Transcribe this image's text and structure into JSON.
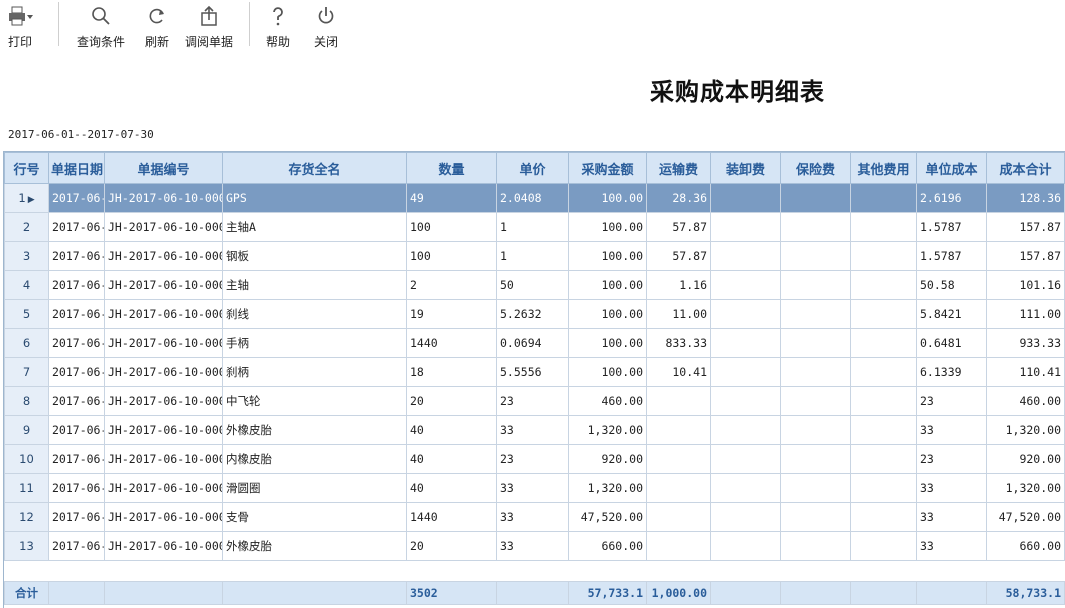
{
  "toolbar": {
    "print": "打印",
    "query": "查询条件",
    "refresh": "刷新",
    "open_doc": "调阅单据",
    "help": "帮助",
    "close": "关闭"
  },
  "report": {
    "title": "采购成本明细表",
    "date_range": "2017-06-01--2017-07-30"
  },
  "columns": [
    "行号",
    "单据日期",
    "单据编号",
    "存货全名",
    "数量",
    "单价",
    "采购金额",
    "运输费",
    "装卸费",
    "保险费",
    "其他费用",
    "单位成本",
    "成本合计"
  ],
  "rows": [
    {
      "no": "1",
      "date": "2017-06-",
      "code": "JH-2017-06-10-000",
      "name": "GPS",
      "qty": "49",
      "price": "2.0408",
      "amount": "100.00",
      "freight": "28.36",
      "handling": "",
      "insurance": "",
      "other": "",
      "unit_cost": "2.6196",
      "total_cost": "128.36"
    },
    {
      "no": "2",
      "date": "2017-06-",
      "code": "JH-2017-06-10-000",
      "name": "主轴A",
      "qty": "100",
      "price": "1",
      "amount": "100.00",
      "freight": "57.87",
      "handling": "",
      "insurance": "",
      "other": "",
      "unit_cost": "1.5787",
      "total_cost": "157.87"
    },
    {
      "no": "3",
      "date": "2017-06-",
      "code": "JH-2017-06-10-000",
      "name": "钢板",
      "qty": "100",
      "price": "1",
      "amount": "100.00",
      "freight": "57.87",
      "handling": "",
      "insurance": "",
      "other": "",
      "unit_cost": "1.5787",
      "total_cost": "157.87"
    },
    {
      "no": "4",
      "date": "2017-06-",
      "code": "JH-2017-06-10-000",
      "name": "主轴",
      "qty": "2",
      "price": "50",
      "amount": "100.00",
      "freight": "1.16",
      "handling": "",
      "insurance": "",
      "other": "",
      "unit_cost": "50.58",
      "total_cost": "101.16"
    },
    {
      "no": "5",
      "date": "2017-06-",
      "code": "JH-2017-06-10-000",
      "name": "刹线",
      "qty": "19",
      "price": "5.2632",
      "amount": "100.00",
      "freight": "11.00",
      "handling": "",
      "insurance": "",
      "other": "",
      "unit_cost": "5.8421",
      "total_cost": "111.00"
    },
    {
      "no": "6",
      "date": "2017-06-",
      "code": "JH-2017-06-10-000",
      "name": "手柄",
      "qty": "1440",
      "price": "0.0694",
      "amount": "100.00",
      "freight": "833.33",
      "handling": "",
      "insurance": "",
      "other": "",
      "unit_cost": "0.6481",
      "total_cost": "933.33"
    },
    {
      "no": "7",
      "date": "2017-06-",
      "code": "JH-2017-06-10-000",
      "name": "刹柄",
      "qty": "18",
      "price": "5.5556",
      "amount": "100.00",
      "freight": "10.41",
      "handling": "",
      "insurance": "",
      "other": "",
      "unit_cost": "6.1339",
      "total_cost": "110.41"
    },
    {
      "no": "8",
      "date": "2017-06-",
      "code": "JH-2017-06-10-000",
      "name": "中飞轮",
      "qty": "20",
      "price": "23",
      "amount": "460.00",
      "freight": "",
      "handling": "",
      "insurance": "",
      "other": "",
      "unit_cost": "23",
      "total_cost": "460.00"
    },
    {
      "no": "9",
      "date": "2017-06-",
      "code": "JH-2017-06-10-000",
      "name": "外橡皮胎",
      "qty": "40",
      "price": "33",
      "amount": "1,320.00",
      "freight": "",
      "handling": "",
      "insurance": "",
      "other": "",
      "unit_cost": "33",
      "total_cost": "1,320.00"
    },
    {
      "no": "10",
      "date": "2017-06-",
      "code": "JH-2017-06-10-000",
      "name": "内橡皮胎",
      "qty": "40",
      "price": "23",
      "amount": "920.00",
      "freight": "",
      "handling": "",
      "insurance": "",
      "other": "",
      "unit_cost": "23",
      "total_cost": "920.00"
    },
    {
      "no": "11",
      "date": "2017-06-",
      "code": "JH-2017-06-10-000",
      "name": "滑圆圈",
      "qty": "40",
      "price": "33",
      "amount": "1,320.00",
      "freight": "",
      "handling": "",
      "insurance": "",
      "other": "",
      "unit_cost": "33",
      "total_cost": "1,320.00"
    },
    {
      "no": "12",
      "date": "2017-06-",
      "code": "JH-2017-06-10-000",
      "name": "支骨",
      "qty": "1440",
      "price": "33",
      "amount": "47,520.00",
      "freight": "",
      "handling": "",
      "insurance": "",
      "other": "",
      "unit_cost": "33",
      "total_cost": "47,520.00"
    },
    {
      "no": "13",
      "date": "2017-06-",
      "code": "JH-2017-06-10-000",
      "name": "外橡皮胎",
      "qty": "20",
      "price": "33",
      "amount": "660.00",
      "freight": "",
      "handling": "",
      "insurance": "",
      "other": "",
      "unit_cost": "33",
      "total_cost": "660.00"
    }
  ],
  "totals": {
    "label": "合计",
    "qty": "3502",
    "amount": "57,733.1",
    "freight": "1,000.00",
    "total_cost": "58,733.1"
  },
  "selected_row": 0,
  "colors": {
    "header_bg": "#d6e5f5",
    "header_text": "#2a5d9a",
    "selected_bg": "#7a9bc2"
  }
}
